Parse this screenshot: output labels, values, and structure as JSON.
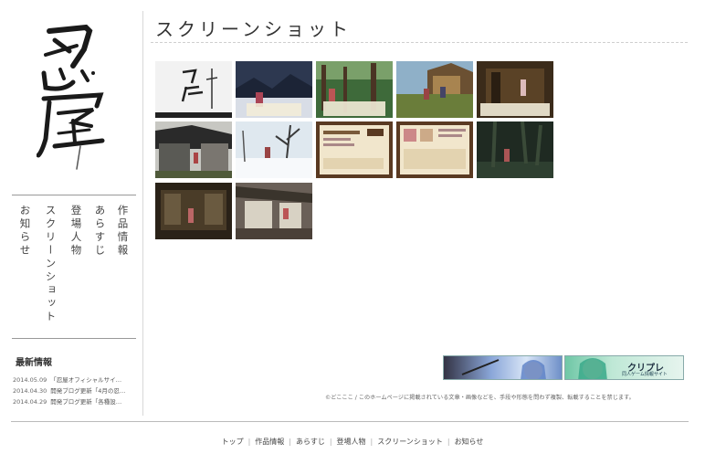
{
  "logo": {
    "text": "忍屋"
  },
  "sidebar": {
    "nav": [
      {
        "label": "作品情報"
      },
      {
        "label": "あらすじ"
      },
      {
        "label": "登場人物"
      },
      {
        "label": "スクリーンショット"
      },
      {
        "label": "お知らせ"
      }
    ],
    "news": {
      "title": "最新情報",
      "items": [
        {
          "date": "2014.05.09",
          "text": "「忍屋オフィシャルサイ…"
        },
        {
          "date": "2014.04.30",
          "text": "開発ブログ更新「4月の忍…"
        },
        {
          "date": "2014.04.29",
          "text": "開発ブログ更新「各種設…"
        }
      ]
    }
  },
  "main": {
    "title": "スクリーンショット",
    "thumbnail_count": 12
  },
  "banners": [
    {
      "label": ""
    },
    {
      "label": "クリプレ",
      "sub": "同人ゲーム情報サイト"
    }
  ],
  "copyright": "©どこここ / このホームページに掲載されている文章・画像などを、手段や形態を問わず複製、転載することを禁じます。",
  "footer": {
    "links": [
      {
        "label": "トップ"
      },
      {
        "label": "作品情報"
      },
      {
        "label": "あらすじ"
      },
      {
        "label": "登場人物"
      },
      {
        "label": "スクリーンショット"
      },
      {
        "label": "お知らせ"
      }
    ]
  },
  "colors": {
    "accent": "#c0392b",
    "rule": "#999999",
    "text": "#333333"
  }
}
